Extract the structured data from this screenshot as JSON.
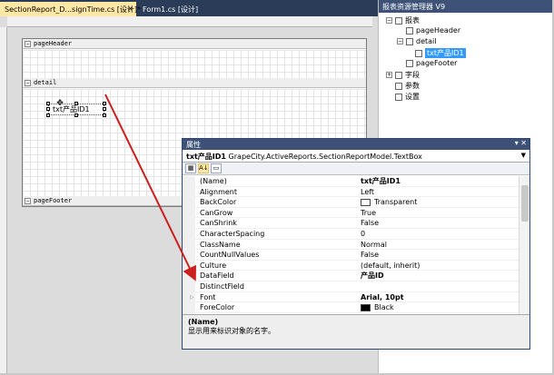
{
  "tabs": [
    {
      "label": "SectionReport_D...signTime.cs [设计]*",
      "close": "×"
    },
    {
      "label": "Form1.cs [设计]"
    }
  ],
  "design": {
    "bands": {
      "header": "pageHeader",
      "detail": "detail",
      "footer": "pageFooter"
    },
    "textbox_label": "txt产品ID1"
  },
  "explorer": {
    "title": "报表资源管理器 V9",
    "items": [
      {
        "label": "报表"
      },
      {
        "label": "pageHeader"
      },
      {
        "label": "detail"
      },
      {
        "label": "txt产品ID1"
      },
      {
        "label": "pageFooter"
      },
      {
        "label": "字段"
      },
      {
        "label": "参数"
      },
      {
        "label": "设置"
      }
    ]
  },
  "properties": {
    "title": "属性",
    "object_name": "txt产品ID1",
    "object_type": "GrapeCity.ActiveReports.SectionReportModel.TextBox",
    "rows": [
      {
        "name": "(Name)",
        "value": "txt产品ID1"
      },
      {
        "name": "Alignment",
        "value": "Left"
      },
      {
        "name": "BackColor",
        "value": "Transparent"
      },
      {
        "name": "CanGrow",
        "value": "True"
      },
      {
        "name": "CanShrink",
        "value": "False"
      },
      {
        "name": "CharacterSpacing",
        "value": "0"
      },
      {
        "name": "ClassName",
        "value": "Normal"
      },
      {
        "name": "CountNullValues",
        "value": "False"
      },
      {
        "name": "Culture",
        "value": "(default, inherit)"
      },
      {
        "name": "DataField",
        "value": "产品ID"
      },
      {
        "name": "DistinctField",
        "value": ""
      },
      {
        "name": "Font",
        "value": "Arial, 10pt"
      },
      {
        "name": "ForeColor",
        "value": "Black"
      }
    ],
    "desc_title": "(Name)",
    "desc_text": "显示用来标识对象的名字。"
  },
  "colors": {
    "tab_bar": "#2b3c59",
    "active_tab": "#ffe8a6",
    "selection": "#3399ff",
    "arrow": "#cc1f1f"
  }
}
